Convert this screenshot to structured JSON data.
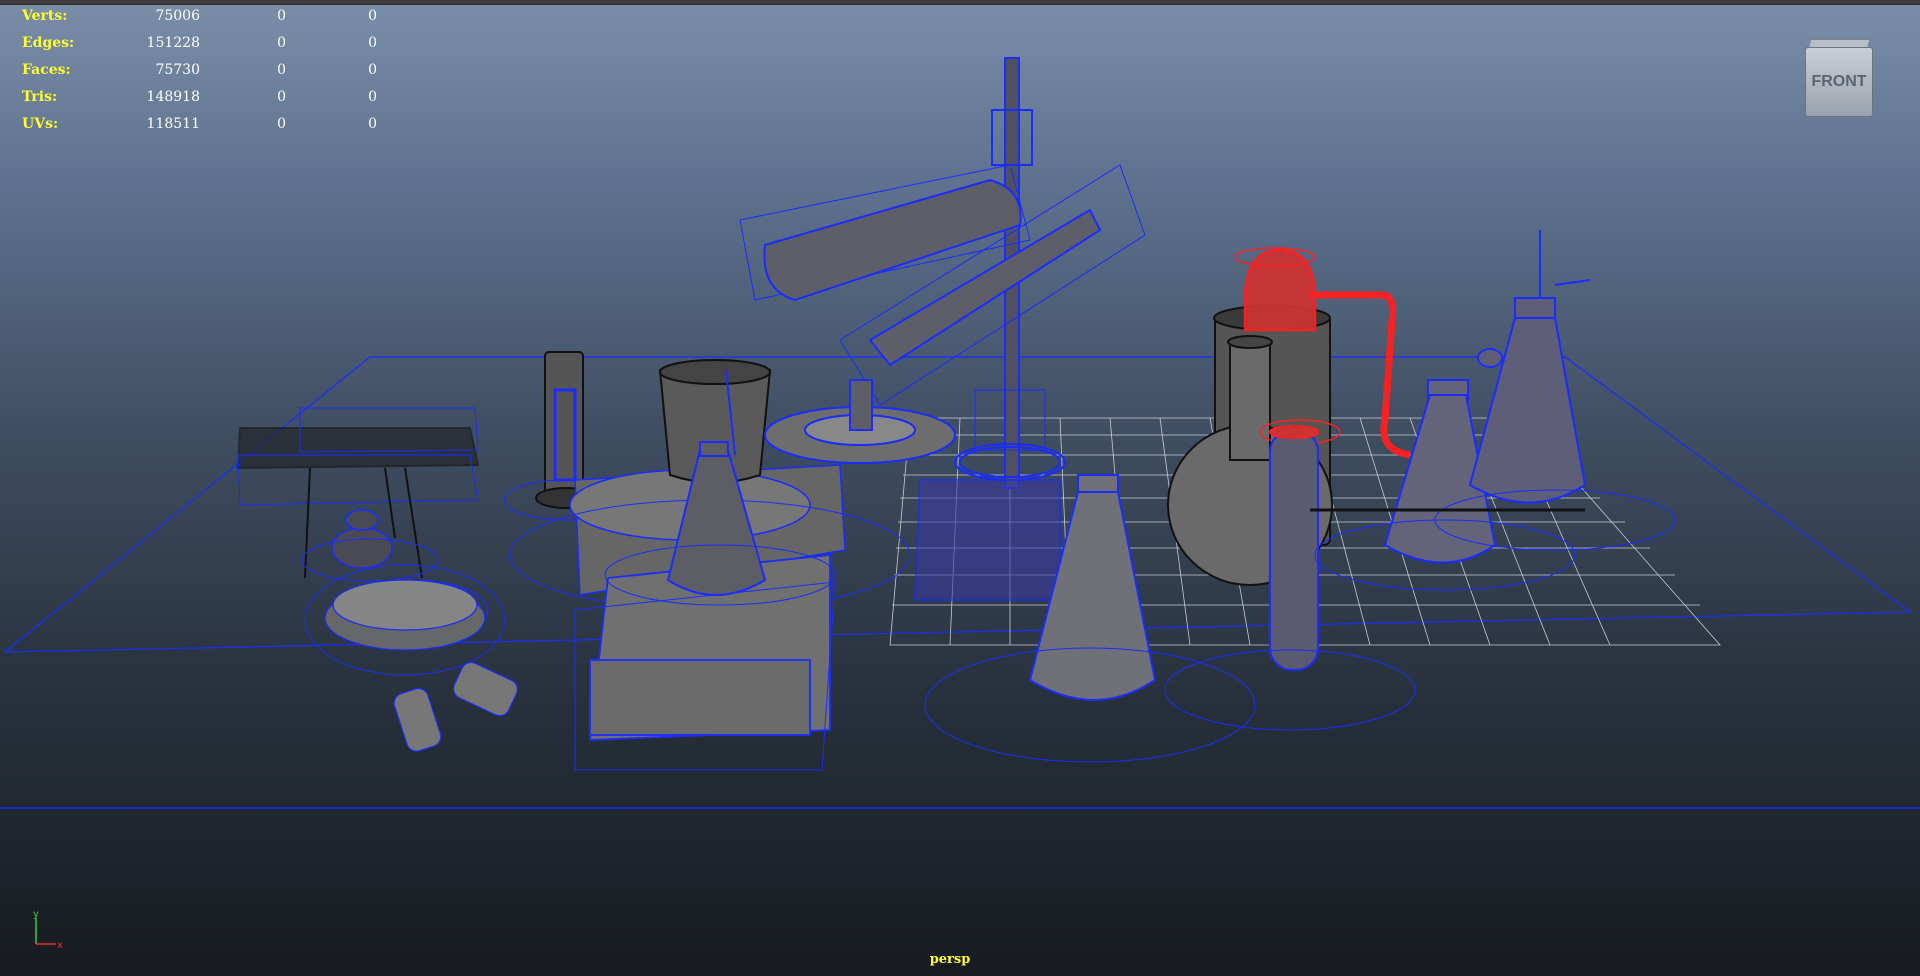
{
  "hud": {
    "rows": [
      {
        "label": "Verts:",
        "total": "75006",
        "selected": "0",
        "tris_sel": "0"
      },
      {
        "label": "Edges:",
        "total": "151228",
        "selected": "0",
        "tris_sel": "0"
      },
      {
        "label": "Faces:",
        "total": "75730",
        "selected": "0",
        "tris_sel": "0"
      },
      {
        "label": "Tris:",
        "total": "148918",
        "selected": "0",
        "tris_sel": "0"
      },
      {
        "label": "UVs:",
        "total": "118511",
        "selected": "0",
        "tris_sel": "0"
      }
    ]
  },
  "viewcube": {
    "face_label": "FRONT"
  },
  "axis": {
    "y_label": "y",
    "x_label": "x"
  },
  "camera": {
    "label": "persp"
  },
  "colors": {
    "hud_label": "#ffff30",
    "wire_selected": "#1a2cff",
    "wire_highlight": "#ff2020",
    "wire_unselected": "#111111",
    "grid": "#c8ccd2"
  }
}
